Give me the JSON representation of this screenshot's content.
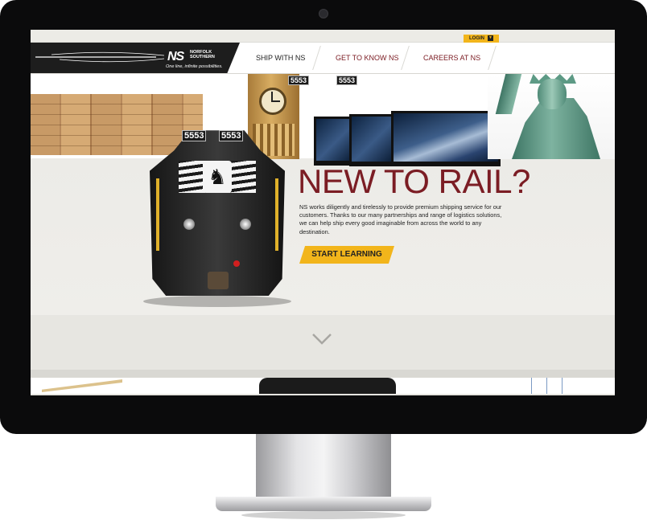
{
  "logo": {
    "mark": "NS",
    "name_line1": "NORFOLK",
    "name_line2": "SOUTHERN",
    "tagline": "One line, infinite possibilities."
  },
  "topbar": {
    "login_label": "LOGIN",
    "login_caret": "▼"
  },
  "nav": {
    "items": [
      {
        "label": "SHIP WITH NS"
      },
      {
        "label": "GET TO KNOW NS"
      },
      {
        "label": "CAREERS AT NS"
      }
    ]
  },
  "hero": {
    "title": "NEW TO RAIL?",
    "body": "NS works diligently and tirelessly to provide premium shipping service for our customers. Thanks to our many partnerships and range of logistics solutions, we can help ship every good imaginable from across the world to any destination.",
    "cta_label": "START LEARNING",
    "scroll_icon": "chevron-down-icon"
  },
  "locomotive": {
    "number": "5553"
  },
  "colors": {
    "brand_red": "#7b1d24",
    "accent_yellow": "#f2b51b",
    "nav_dark": "#1d1d1d"
  }
}
